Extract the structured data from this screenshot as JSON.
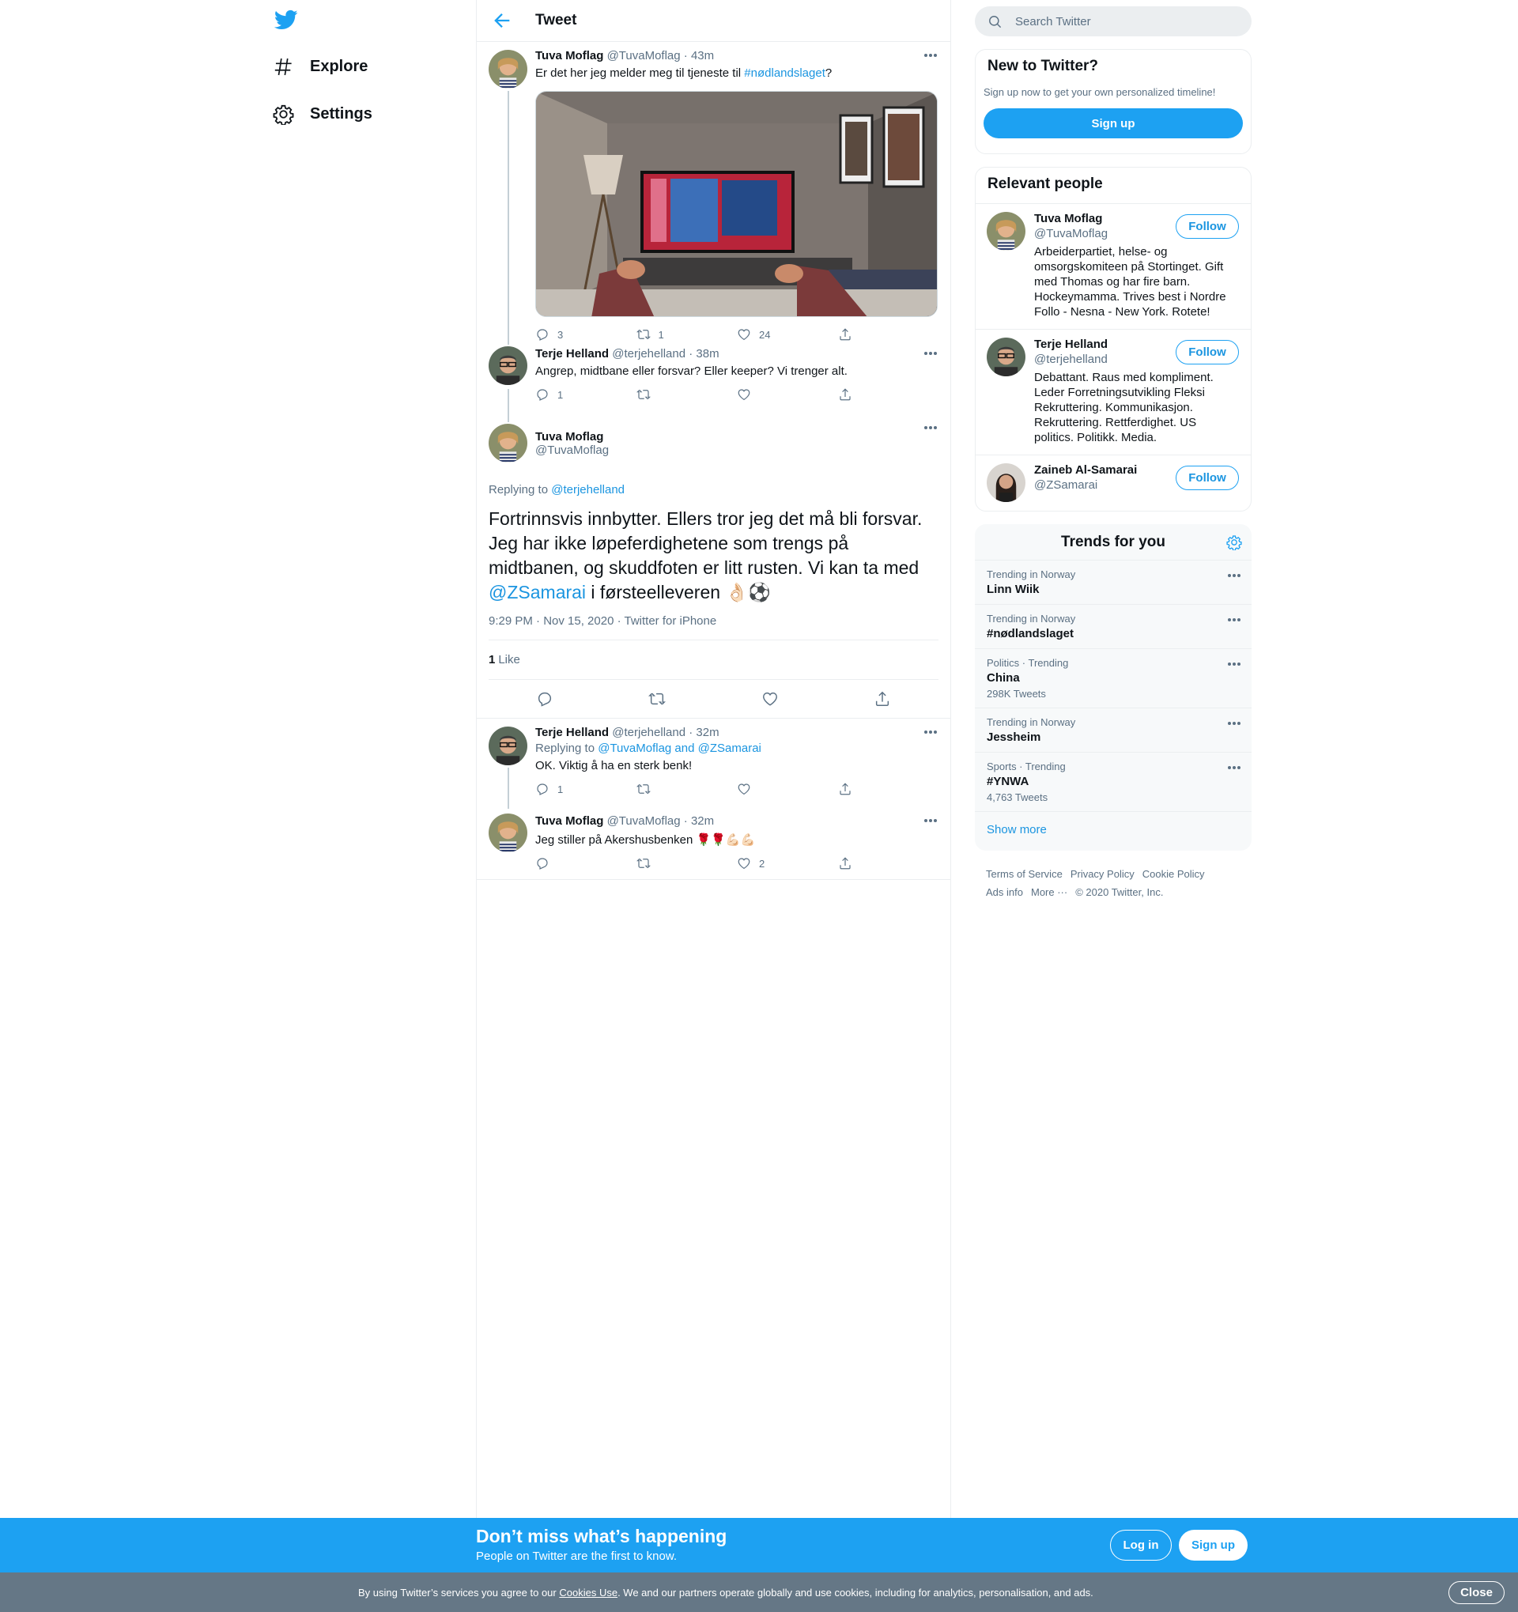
{
  "nav": {
    "explore": "Explore",
    "settings": "Settings"
  },
  "header": {
    "title": "Tweet"
  },
  "tweets": [
    {
      "name": "Tuva Moflag",
      "handle": "@TuvaMoflag",
      "time": "· 43m",
      "text_before": "Er det her jeg melder meg til tjeneste til ",
      "hashtag": "#nødlandslaget",
      "text_after": "?",
      "replies": "3",
      "retweets": "1",
      "likes": "24"
    },
    {
      "name": "Terje Helland",
      "handle": "@terjehelland",
      "time": "· 38m",
      "text": "Angrep, midtbane eller forsvar? Eller keeper? Vi trenger alt.",
      "replies": "1",
      "retweets": "",
      "likes": ""
    }
  ],
  "focus": {
    "name": "Tuva Moflag",
    "handle": "@TuvaMoflag",
    "replying_prefix": "Replying to ",
    "replying_to": "@terjehelland",
    "text_before": "Fortrinnsvis innbytter. Ellers tror jeg det må bli forsvar. Jeg har ikke løpeferdighetene som trengs på midtbanen, og skuddfoten er litt rusten. Vi kan ta med ",
    "mention": "@ZSamarai",
    "text_after": " i førsteelleveren 👌🏻⚽",
    "meta": "9:29 PM · Nov 15, 2020 · Twitter for iPhone",
    "like_count": "1",
    "like_label": "Like"
  },
  "replies": [
    {
      "name": "Terje Helland",
      "handle": "@terjehelland",
      "time": "· 32m",
      "replying_prefix": "Replying to ",
      "replying_to": "@TuvaMoflag and @ZSamarai",
      "text": "OK. Viktig å ha en sterk benk!",
      "replies": "1",
      "retweets": "",
      "likes": ""
    },
    {
      "name": "Tuva Moflag",
      "handle": "@TuvaMoflag",
      "time": "· 32m",
      "text": "Jeg stiller på Akershusbenken 🌹🌹💪🏻💪🏻",
      "replies": "",
      "retweets": "",
      "likes": "2"
    }
  ],
  "search": {
    "placeholder": "Search Twitter"
  },
  "new_to_twitter": {
    "title": "New to Twitter?",
    "subtitle": "Sign up now to get your own personalized timeline!",
    "button": "Sign up"
  },
  "relevant": {
    "title": "Relevant people",
    "follow_label": "Follow",
    "people": [
      {
        "name": "Tuva Moflag",
        "handle": "@TuvaMoflag",
        "bio": "Arbeiderpartiet, helse- og omsorgskomiteen på Stortinget. Gift med Thomas og har fire barn. Hockeymamma. Trives best i Nordre Follo - Nesna - New York. Rotete!"
      },
      {
        "name": "Terje Helland",
        "handle": "@terjehelland",
        "bio": "Debattant. Raus med kompliment. Leder Forretningsutvikling Fleksi Rekruttering. Kommunikasjon. Rekruttering. Rettferdighet. US politics. Politikk. Media."
      },
      {
        "name": "Zaineb Al-Samarai",
        "handle": "@ZSamarai",
        "bio": ""
      }
    ]
  },
  "trends": {
    "title": "Trends for you",
    "items": [
      {
        "context": "Trending in Norway",
        "name": "Linn Wiik",
        "count": ""
      },
      {
        "context": "Trending in Norway",
        "name": "#nødlandslaget",
        "count": ""
      },
      {
        "context": "Politics · Trending",
        "name": "China",
        "count": "298K Tweets"
      },
      {
        "context": "Trending in Norway",
        "name": "Jessheim",
        "count": ""
      },
      {
        "context": "Sports · Trending",
        "name": "#YNWA",
        "count": "4,763 Tweets"
      }
    ],
    "show_more": "Show more"
  },
  "footer": {
    "tos": "Terms of Service",
    "privacy": "Privacy Policy",
    "cookie": "Cookie Policy",
    "ads": "Ads info",
    "more": "More ···",
    "copyright": "© 2020 Twitter, Inc."
  },
  "promo": {
    "title": "Don’t miss what’s happening",
    "subtitle": "People on Twitter are the first to know.",
    "login": "Log in",
    "signup": "Sign up"
  },
  "cookie_bar": {
    "text_before": "By using Twitter’s services you agree to our ",
    "link": "Cookies Use",
    "text_after": ". We and our partners operate globally and use cookies, including for analytics, personalisation, and ads.",
    "close": "Close"
  },
  "colors": {
    "accent": "#1da1f2",
    "link": "#1b95e0",
    "muted": "#5b7083",
    "cookie_bg": "#657786"
  }
}
